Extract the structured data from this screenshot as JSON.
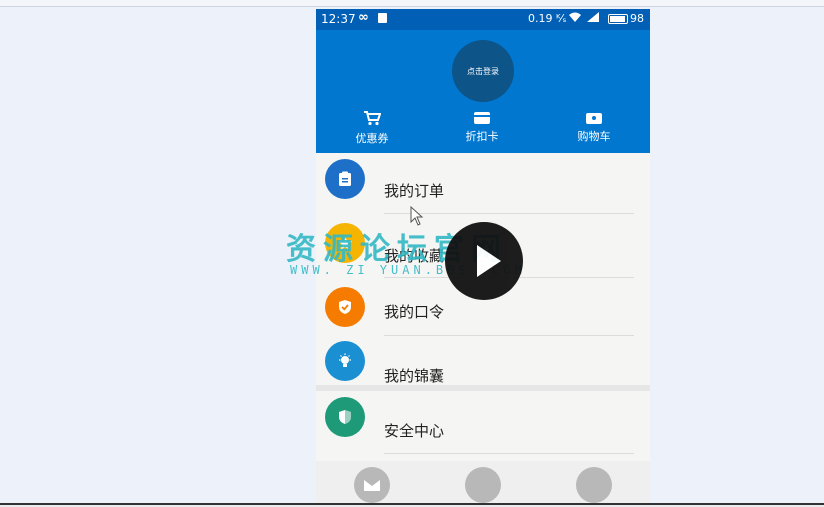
{
  "status_bar": {
    "time": "12:37",
    "infinity": "∞",
    "speed": "0.19 ᴷ⁄ₛ",
    "battery": "98"
  },
  "header": {
    "avatar_text": "点击登录",
    "links": [
      {
        "label": "优惠券",
        "icon": "cart-icon"
      },
      {
        "label": "折扣卡",
        "icon": "card-icon"
      },
      {
        "label": "购物车",
        "icon": "ticket-icon"
      }
    ]
  },
  "menu": [
    {
      "label": "我的订单",
      "icon": "clipboard-icon",
      "color": "#1d6fc7"
    },
    {
      "label": "我的收藏",
      "icon": "star-icon",
      "color": "#f5b400"
    },
    {
      "label": "我的口令",
      "icon": "shield-check-icon",
      "color": "#f57c00"
    },
    {
      "label": "我的锦囊",
      "icon": "lightbulb-icon",
      "color": "#1a8fd1"
    }
  ],
  "menu2": [
    {
      "label": "安全中心",
      "icon": "security-shield-icon",
      "color": "#1e9a78"
    }
  ],
  "watermark": {
    "title": "资源论坛官网",
    "url": "WWW. ZI YUAN.BBS .COM"
  }
}
